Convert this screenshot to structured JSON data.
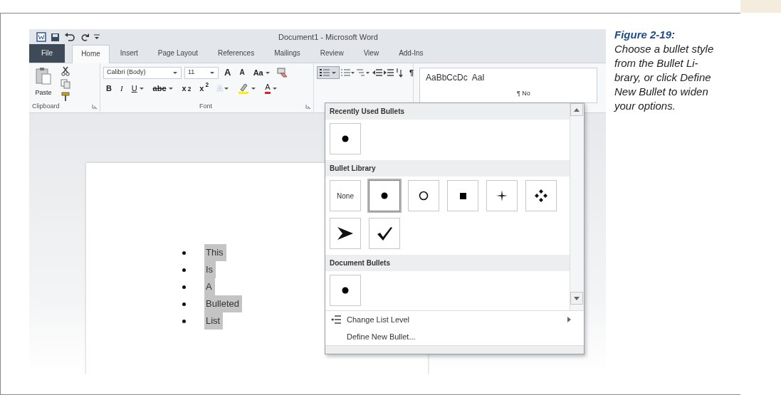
{
  "window": {
    "title": "Document1 - Microsoft Word"
  },
  "tabs": [
    {
      "label": "File",
      "kind": "file",
      "selected": false
    },
    {
      "label": "Home",
      "kind": "tab",
      "selected": true
    },
    {
      "label": "Insert",
      "kind": "tab",
      "selected": false
    },
    {
      "label": "Page Layout",
      "kind": "tab",
      "selected": false
    },
    {
      "label": "References",
      "kind": "tab",
      "selected": false
    },
    {
      "label": "Mailings",
      "kind": "tab",
      "selected": false
    },
    {
      "label": "Review",
      "kind": "tab",
      "selected": false
    },
    {
      "label": "View",
      "kind": "tab",
      "selected": false
    },
    {
      "label": "Add-Ins",
      "kind": "tab",
      "selected": false
    }
  ],
  "ribbon": {
    "clipboard": {
      "label": "Clipboard",
      "paste": "Paste"
    },
    "font": {
      "label": "Font",
      "font_name": "Calibri (Body)",
      "font_size": "11",
      "grow": "A",
      "shrink": "A",
      "change_case": "Aa",
      "bold": "B",
      "italic": "I",
      "underline": "U",
      "strike": "abc",
      "subscript": "x$_{2}$",
      "superscript": "x$^{2}$",
      "effects": "A",
      "font_color_label": "A"
    },
    "paragraph": {
      "bullets_active": true,
      "show_marks": "¶"
    },
    "styles": {
      "samples": [
        "AaBbCcDc",
        "AaI"
      ],
      "name_fragment": "¶ No"
    }
  },
  "document": {
    "list": [
      {
        "text": "This",
        "selected": true
      },
      {
        "text": "Is",
        "selected": true
      },
      {
        "text": "A",
        "selected": true
      },
      {
        "text": "Bulleted",
        "selected": true
      },
      {
        "text": "List",
        "selected": true
      }
    ]
  },
  "bullet_menu": {
    "sections": [
      {
        "title": "Recently Used Bullets",
        "bullets": [
          {
            "kind": "dot",
            "selected": false
          }
        ]
      },
      {
        "title": "Bullet Library",
        "bullets": [
          {
            "kind": "none",
            "label": "None",
            "selected": false
          },
          {
            "kind": "dot",
            "selected": true
          },
          {
            "kind": "circle",
            "selected": false
          },
          {
            "kind": "square",
            "selected": false
          },
          {
            "kind": "star",
            "selected": false
          },
          {
            "kind": "diamonds",
            "selected": false
          },
          {
            "kind": "arrow",
            "selected": false
          },
          {
            "kind": "check",
            "selected": false
          }
        ]
      },
      {
        "title": "Document Bullets",
        "bullets": [
          {
            "kind": "dot",
            "selected": false
          }
        ]
      }
    ],
    "commands": [
      {
        "label": "Change List Level",
        "icon": true,
        "submenu": true
      },
      {
        "label": "Define New Bullet...",
        "icon": false,
        "submenu": false
      }
    ]
  },
  "caption": {
    "figure": "Figure 2-19:",
    "text": "Choose a bullet style from the Bullet Li-brary, or click Define New Bullet to widen your options."
  }
}
